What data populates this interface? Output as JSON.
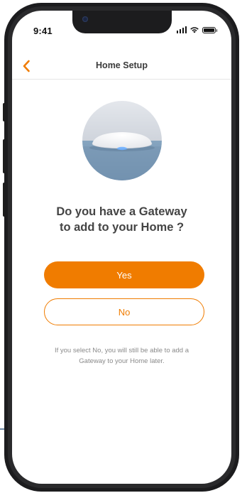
{
  "status_bar": {
    "time": "9:41",
    "icons": [
      "signal-icon",
      "wifi-icon",
      "battery-icon"
    ]
  },
  "nav": {
    "back_icon": "chevron-left-icon",
    "title": "Home Setup"
  },
  "illustration": {
    "icon": "gateway-device-icon"
  },
  "question": {
    "line1": "Do you have a Gateway",
    "line2": "to add to your Home ?"
  },
  "buttons": {
    "yes_label": "Yes",
    "no_label": "No"
  },
  "note": {
    "line1": "If you select No, you will still be able to add a",
    "line2": "Gateway to your Home later."
  },
  "colors": {
    "accent": "#f07c00",
    "title_text": "#3b3b3b",
    "question_text": "#444444",
    "note_text": "#8a8a8a",
    "illustration_top": "#d9dde3",
    "illustration_bottom": "#7a9bb8"
  }
}
